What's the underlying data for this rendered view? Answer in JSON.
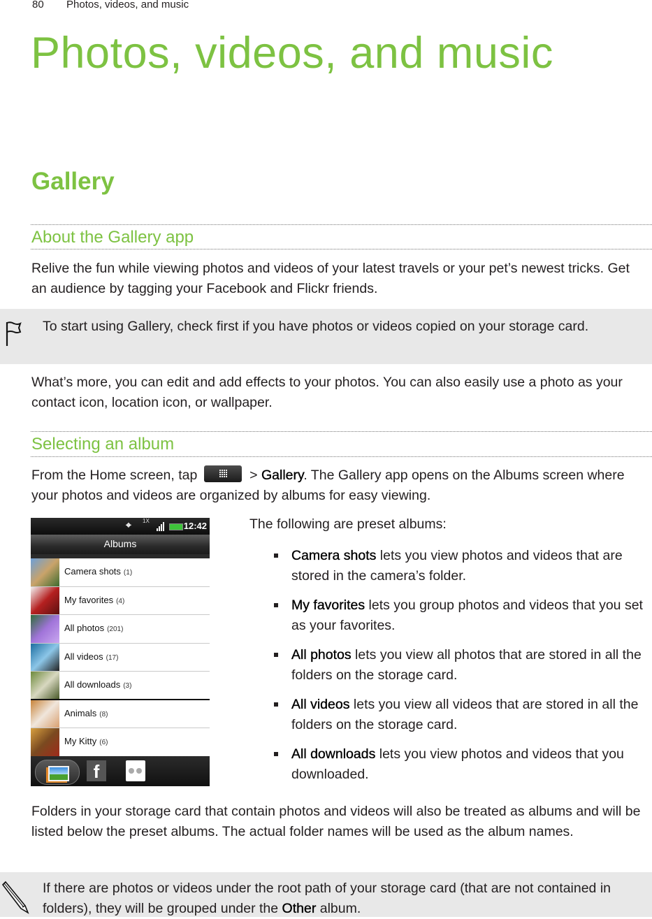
{
  "running_header": {
    "page_number": "80",
    "chapter": "Photos, videos, and music"
  },
  "chapter_title": "Photos, videos, and music",
  "section_title": "Gallery",
  "subsections": {
    "about": {
      "heading": "About the Gallery app",
      "para1": "Relive the fun while viewing photos and videos of your latest travels or your pet’s newest tricks. Get an audience by tagging your Facebook and Flickr friends.",
      "note": {
        "icon": "flag-icon",
        "text": "To start using Gallery, check first if you have photos or videos copied on your storage card."
      },
      "para2": "What’s more, you can edit and add effects to your photos. You can also easily use a photo as your contact icon, location icon, or wallpaper."
    },
    "selecting": {
      "heading": "Selecting an album",
      "intro_before": "From the Home screen, tap ",
      "intro_icon": "all-apps-grid-icon",
      "intro_sep": " > ",
      "intro_bold": "Gallery",
      "intro_after": ". The Gallery app opens on the Albums screen where your photos and videos are organized by albums for easy viewing.",
      "list_intro": "The following are preset albums:",
      "preset_albums": [
        {
          "name": "Camera shots",
          "desc": " lets you view photos and videos that are stored in the camera’s folder."
        },
        {
          "name": "My favorites",
          "desc": " lets you group photos and videos that you set as your favorites."
        },
        {
          "name": "All photos",
          "desc": " lets you view all photos that are stored in all the folders on the storage card."
        },
        {
          "name": "All videos",
          "desc": " lets you view all videos that are stored in all the folders on the storage card."
        },
        {
          "name": "All downloads",
          "desc": " lets you view photos and videos that you downloaded."
        }
      ],
      "para_folders": "Folders in your storage card that contain photos and videos will also be treated as albums and will be listed below the preset albums. The actual folder names will be used as the album names.",
      "note": {
        "icon": "pencil-icon",
        "text_before": "If there are photos or videos under the root path of your storage card (that are not contained in folders), they will be grouped under the ",
        "text_bold": "Other",
        "text_after": " album."
      }
    }
  },
  "phone_screenshot": {
    "status_bar": {
      "time": "12:42",
      "network": "1X",
      "icons": [
        "gps-icon",
        "network-icon",
        "signal-icon",
        "battery-icon"
      ]
    },
    "title": "Albums",
    "albums": [
      {
        "name": "Camera shots",
        "count": "(1)",
        "thumb_colors": [
          "#6c9fd8",
          "#c9a36a",
          "#3d6b2e"
        ]
      },
      {
        "name": "My favorites",
        "count": "(4)",
        "thumb_colors": [
          "#f2f2f2",
          "#b52020",
          "#5a1010"
        ]
      },
      {
        "name": "All photos",
        "count": "(201)",
        "thumb_colors": [
          "#2f6c3a",
          "#a074d9",
          "#c9a7f0"
        ]
      },
      {
        "name": "All videos",
        "count": "(17)",
        "thumb_colors": [
          "#1d6ea0",
          "#8cc6e8",
          "#222222"
        ]
      },
      {
        "name": "All downloads",
        "count": "(3)",
        "thumb_colors": [
          "#6d8a3c",
          "#d8d8c0",
          "#4a5a2a"
        ]
      },
      {
        "name": "Animals",
        "count": "(8)",
        "thumb_colors": [
          "#c8843a",
          "#f0e6dc",
          "#d9a070"
        ]
      },
      {
        "name": "My Kitty",
        "count": "(6)",
        "thumb_colors": [
          "#d8a040",
          "#7a4a20",
          "#a02a1a"
        ]
      }
    ],
    "tabs": [
      {
        "name": "gallery-tab",
        "icon": "gallery-icon",
        "selected": true
      },
      {
        "name": "facebook-tab",
        "icon": "facebook-icon",
        "glyph": "f"
      },
      {
        "name": "flickr-tab",
        "icon": "flickr-icon"
      }
    ]
  },
  "colors": {
    "accent": "#7dc242",
    "text": "#231f20",
    "note_bg": "#e8e8e8"
  }
}
